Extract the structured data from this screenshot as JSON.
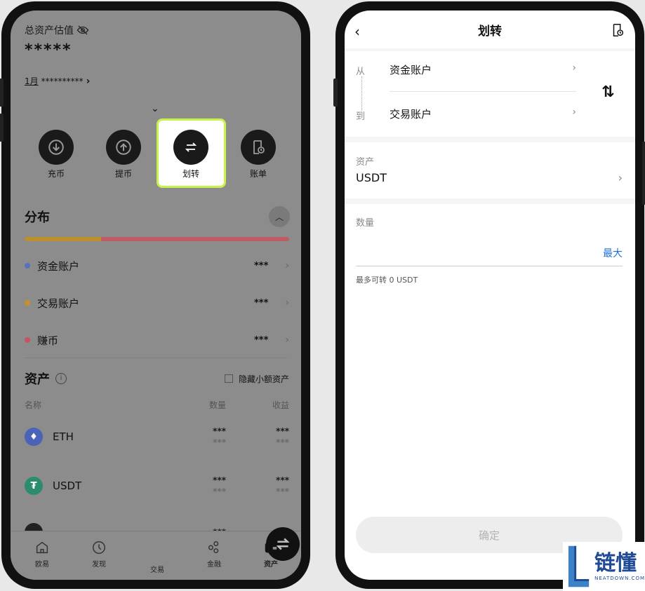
{
  "left": {
    "total_label": "总资产估值",
    "total_value": "*****",
    "month": "1月",
    "month_value": "**********",
    "actions": [
      {
        "label": "充币",
        "icon": "download-icon"
      },
      {
        "label": "提币",
        "icon": "upload-icon"
      },
      {
        "label": "划转",
        "icon": "transfer-icon"
      },
      {
        "label": "账单",
        "icon": "bill-icon"
      }
    ],
    "distribution_title": "分布",
    "distribution": [
      {
        "name": "资金账户",
        "value": "***",
        "color": "#5b6fbf"
      },
      {
        "name": "交易账户",
        "value": "***",
        "color": "#c4922a"
      },
      {
        "name": "赚币",
        "value": "***",
        "color": "#c55463"
      }
    ],
    "assets_title": "资产",
    "hide_small": "隐藏小额资产",
    "columns": {
      "name": "名称",
      "qty": "数量",
      "profit": "收益"
    },
    "coins": [
      {
        "symbol": "ETH",
        "qty": "***",
        "qty_sub": "***",
        "profit": "***",
        "profit_sub": "***",
        "color": "#4a63b8"
      },
      {
        "symbol": "USDT",
        "qty": "***",
        "qty_sub": "***",
        "profit": "***",
        "profit_sub": "***",
        "color": "#2c8c6e"
      },
      {
        "symbol": "",
        "qty": "***",
        "qty_sub": "",
        "profit": "***",
        "profit_sub": "",
        "color": "#222222"
      }
    ],
    "tabs": [
      {
        "label": "欧易",
        "icon": "home-icon"
      },
      {
        "label": "发现",
        "icon": "discover-icon"
      },
      {
        "label": "交易",
        "icon": "trade-icon"
      },
      {
        "label": "金融",
        "icon": "finance-icon"
      },
      {
        "label": "资产",
        "icon": "wallet-icon"
      }
    ]
  },
  "right": {
    "title": "划转",
    "from_label": "从",
    "to_label": "到",
    "from_account": "资金账户",
    "to_account": "交易账户",
    "asset_label": "资产",
    "asset_value": "USDT",
    "amount_label": "数量",
    "max_label": "最大",
    "available": "最多可转 0 USDT",
    "confirm": "确定"
  },
  "watermark": {
    "brand_cn": "链懂",
    "brand_en": "NEATDOWN.COM"
  }
}
